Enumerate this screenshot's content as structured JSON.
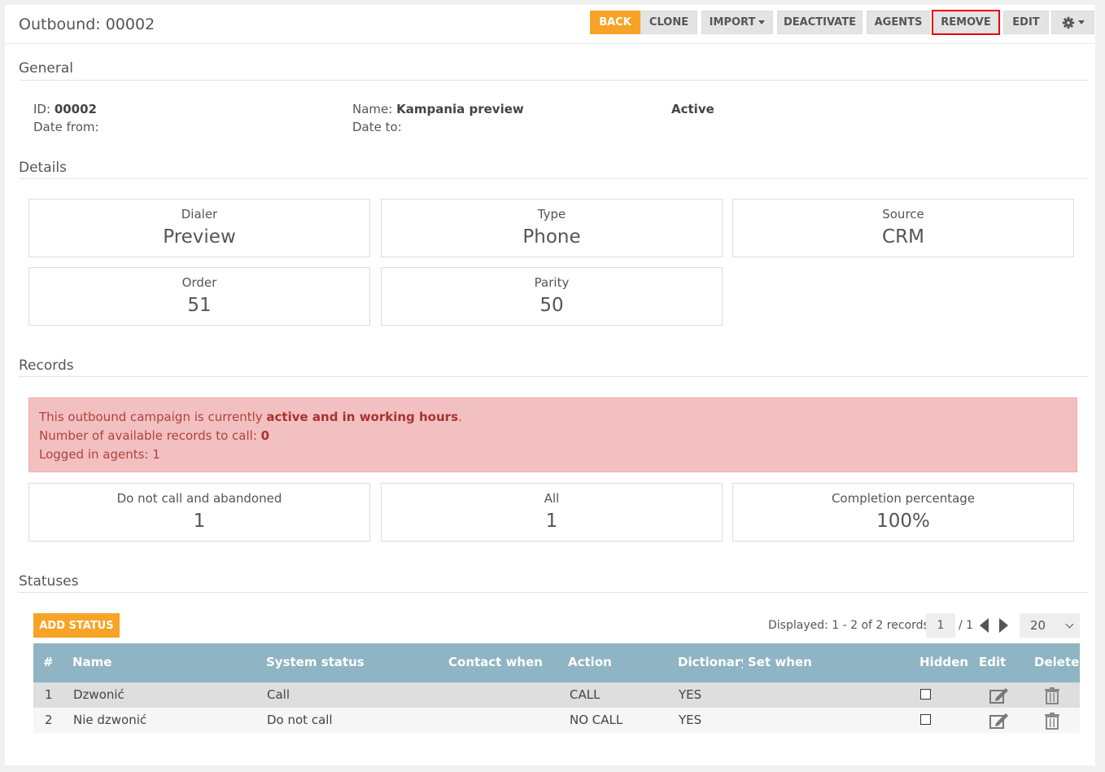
{
  "header": {
    "title": "Outbound: 00002",
    "buttons": {
      "back": "BACK",
      "clone": "CLONE",
      "import": "IMPORT",
      "deactivate": "DEACTIVATE",
      "agents": "AGENTS",
      "remove": "REMOVE",
      "edit": "EDIT"
    },
    "settings_icon": "gear-icon"
  },
  "general": {
    "title": "General",
    "id_label": "ID:",
    "id_value": "00002",
    "date_from_label": "Date from:",
    "name_label": "Name:",
    "name_value": "Kampania preview",
    "date_to_label": "Date to:",
    "status": "Active"
  },
  "details": {
    "title": "Details",
    "cards": [
      {
        "label": "Dialer",
        "value": "Preview"
      },
      {
        "label": "Type",
        "value": "Phone"
      },
      {
        "label": "Source",
        "value": "CRM"
      },
      {
        "label": "Order",
        "value": "51"
      },
      {
        "label": "Parity",
        "value": "50"
      }
    ]
  },
  "records": {
    "title": "Records",
    "alert": {
      "line1_prefix": "This outbound campaign is currently ",
      "line1_bold": "active and in working hours",
      "line1_suffix": ".",
      "line2_prefix": "Number of available records to call: ",
      "line2_bold": "0",
      "line3": "Logged in agents: 1",
      "color": "#f2c0c1"
    },
    "cards": [
      {
        "label": "Do not call and abandoned",
        "value": "1"
      },
      {
        "label": "All",
        "value": "1"
      },
      {
        "label": "Completion percentage",
        "value": "100%"
      }
    ]
  },
  "statuses": {
    "title": "Statuses",
    "add_button": "ADD STATUS",
    "pager": {
      "displayed": "Displayed: 1 - 2 of 2 records",
      "page": "1",
      "total_pages": "/ 1",
      "page_size": "20"
    },
    "columns": [
      "#",
      "Name",
      "System status",
      "Contact when",
      "Action",
      "Dictionary",
      "Set when",
      "Hidden",
      "Edit",
      "Delete"
    ],
    "rows": [
      {
        "num": "1",
        "name": "Dzwonić",
        "system_status": "Call",
        "contact_when": "",
        "action": "CALL",
        "dictionary": "YES",
        "set_when": ""
      },
      {
        "num": "2",
        "name": "Nie dzwonić",
        "system_status": "Do not call",
        "contact_when": "",
        "action": "NO CALL",
        "dictionary": "YES",
        "set_when": ""
      }
    ],
    "header_color": "#8fb4c3"
  },
  "accent_color": "#f7a326"
}
